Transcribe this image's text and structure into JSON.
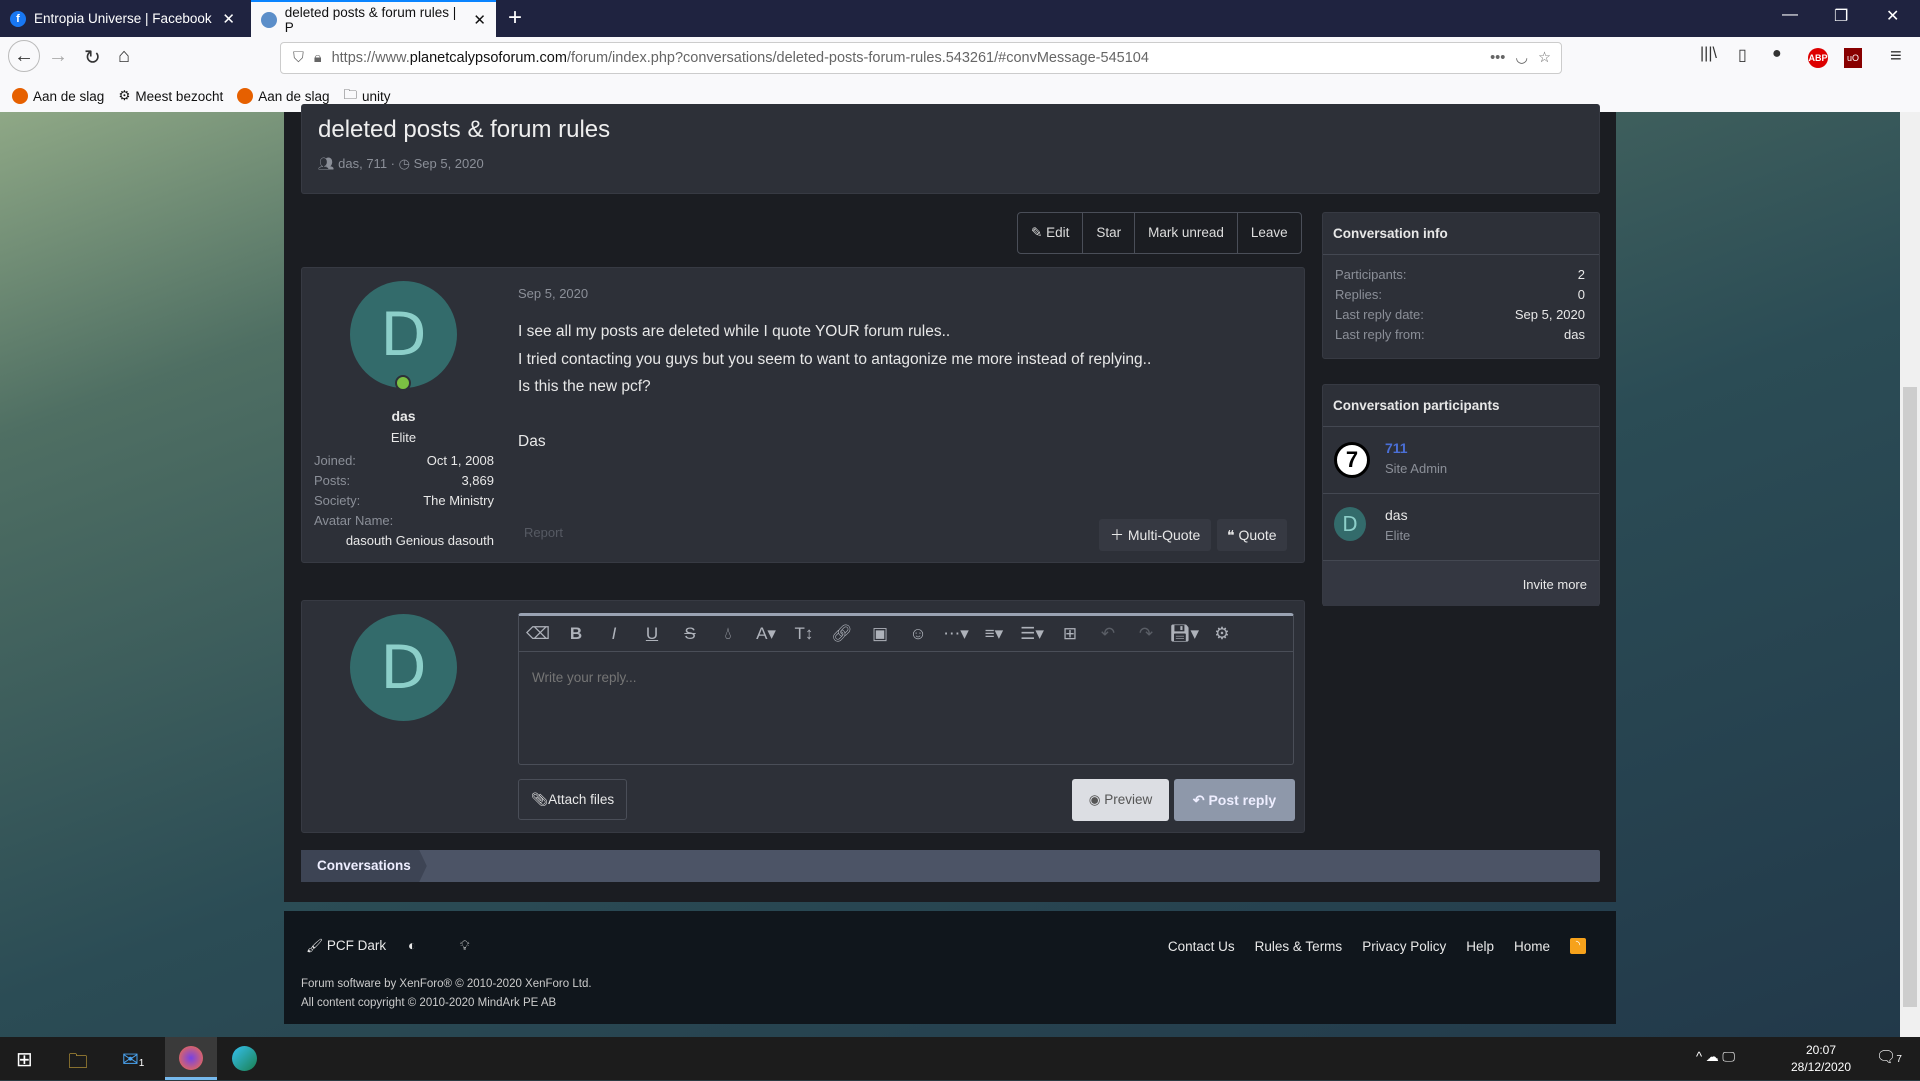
{
  "browser": {
    "tabs": [
      {
        "label": "Entropia Universe | Facebook",
        "active": false
      },
      {
        "label": "deleted posts & forum rules | P",
        "active": true
      }
    ],
    "url_prefix": "https://www.",
    "url_domain": "planetcalypsoforum.com",
    "url_path": "/forum/index.php?conversations/deleted-posts-forum-rules.543261/#convMessage-545104",
    "bookmarks": [
      "Aan de slag",
      "Meest bezocht",
      "Aan de slag",
      "unity"
    ]
  },
  "thread": {
    "title": "deleted posts & forum rules",
    "participants": "das, 711",
    "date": "Sep 5, 2020"
  },
  "actions": {
    "edit": "Edit",
    "star": "Star",
    "mark_unread": "Mark unread",
    "leave": "Leave"
  },
  "post": {
    "avatar_letter": "D",
    "username": "das",
    "user_title": "Elite",
    "stats": [
      {
        "label": "Joined:",
        "value": "Oct 1, 2008"
      },
      {
        "label": "Posts:",
        "value": "3,869"
      },
      {
        "label": "Society:",
        "value": "The Ministry"
      }
    ],
    "avatar_name_label": "Avatar Name:",
    "avatar_name": "dasouth Genious dasouth",
    "date": "Sep 5, 2020",
    "lines": [
      "I see all my posts are deleted while I quote YOUR forum rules..",
      "I tried contacting you guys but you seem to want to antagonize me more instead of replying..",
      "Is this the new pcf?",
      "Das"
    ],
    "report": "Report",
    "multi_quote": "Multi-Quote",
    "quote": "Quote"
  },
  "reply": {
    "placeholder": "Write your reply...",
    "attach": "Attach files",
    "preview": "Preview",
    "post": "Post reply",
    "avatar_letter": "D"
  },
  "sidebar": {
    "info_title": "Conversation info",
    "info": [
      {
        "label": "Participants:",
        "value": "2"
      },
      {
        "label": "Replies:",
        "value": "0"
      },
      {
        "label": "Last reply date:",
        "value": "Sep 5, 2020"
      },
      {
        "label": "Last reply from:",
        "value": "das"
      }
    ],
    "participants_title": "Conversation participants",
    "participants": [
      {
        "name": "711",
        "title": "Site Admin",
        "avatar": "7"
      },
      {
        "name": "das",
        "title": "Elite",
        "avatar": "D"
      }
    ],
    "invite": "Invite more"
  },
  "breadcrumb": "Conversations",
  "footer": {
    "style": "PCF Dark",
    "links": [
      "Contact Us",
      "Rules & Terms",
      "Privacy Policy",
      "Help",
      "Home"
    ],
    "line1": "Forum software by XenForo® © 2010-2020 XenForo Ltd.",
    "line2": "All content copyright © 2010-2020 MindArk PE AB"
  },
  "taskbar": {
    "time": "20:07",
    "date": "28/12/2020",
    "mail_badge": "1",
    "notif_badge": "7"
  },
  "colors": {
    "accent_link": "#4a6fd6",
    "avatar_bg": "#336b6b",
    "online": "#7bc043",
    "rss": "#f7a21b"
  }
}
